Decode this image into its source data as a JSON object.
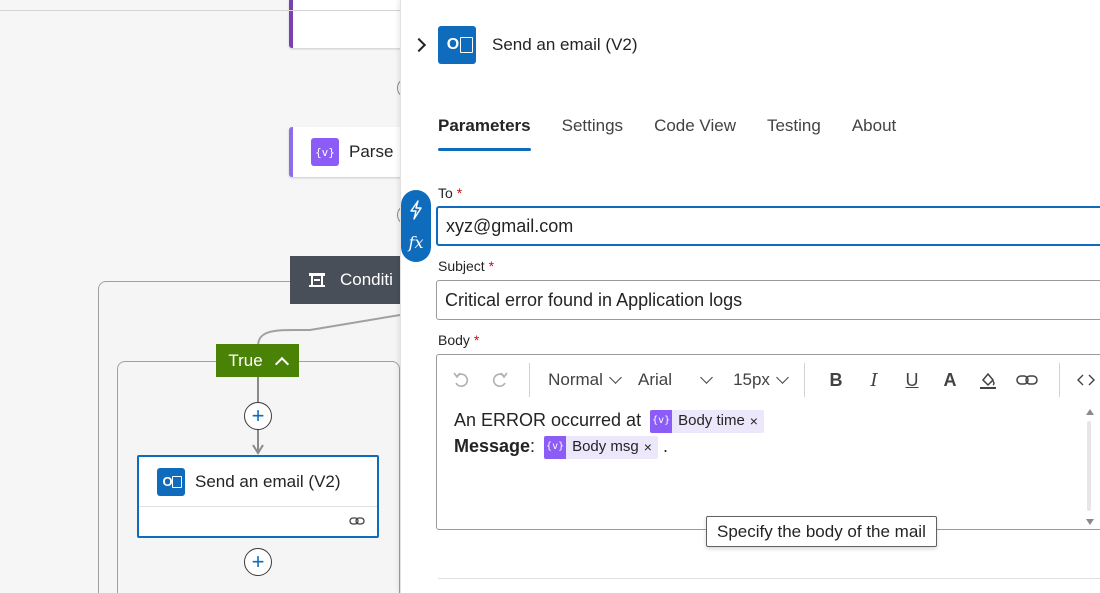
{
  "canvas": {
    "parse_label": "Parse",
    "condition_label": "Conditi",
    "true_label": "True",
    "email_card_title": "Send an email (V2)"
  },
  "panel": {
    "title": "Send an email (V2)",
    "tabs": [
      {
        "label": "Parameters",
        "active": true
      },
      {
        "label": "Settings"
      },
      {
        "label": "Code View"
      },
      {
        "label": "Testing"
      },
      {
        "label": "About"
      }
    ],
    "to": {
      "label": "To",
      "required_mark": "*",
      "value": "xyz@gmail.com"
    },
    "subject": {
      "label": "Subject",
      "required_mark": "*",
      "value": "Critical error found in Application logs"
    },
    "body": {
      "label": "Body",
      "required_mark": "*",
      "toolbar": {
        "paragraph_style": "Normal",
        "font": "Arial",
        "font_size": "15px",
        "bold": "B",
        "italic": "I",
        "underline": "U",
        "font_color": "A"
      },
      "line1_text": "An ERROR occurred at",
      "token1": {
        "label": "Body time",
        "remove": "×"
      },
      "line2_label": "Message",
      "line2_colon": ":",
      "token2": {
        "label": "Body msg",
        "remove": "×"
      },
      "line2_end": "."
    },
    "tooltip": "Specify the body of the mail",
    "fx_label": "fx"
  },
  "colors": {
    "accent": "#0f6cbd",
    "true_branch": "#498205",
    "condition_bar": "#484f58",
    "token": "#8b5cf6",
    "required": "#c50f1f"
  },
  "icons": [
    "chevron-right-icon",
    "outlook-icon",
    "lightning-icon",
    "fx-icon",
    "undo-icon",
    "redo-icon",
    "bold-icon",
    "italic-icon",
    "underline-icon",
    "font-color-icon",
    "highlight-icon",
    "link-icon",
    "code-icon",
    "plus-icon",
    "condition-icon",
    "variable-icon"
  ]
}
